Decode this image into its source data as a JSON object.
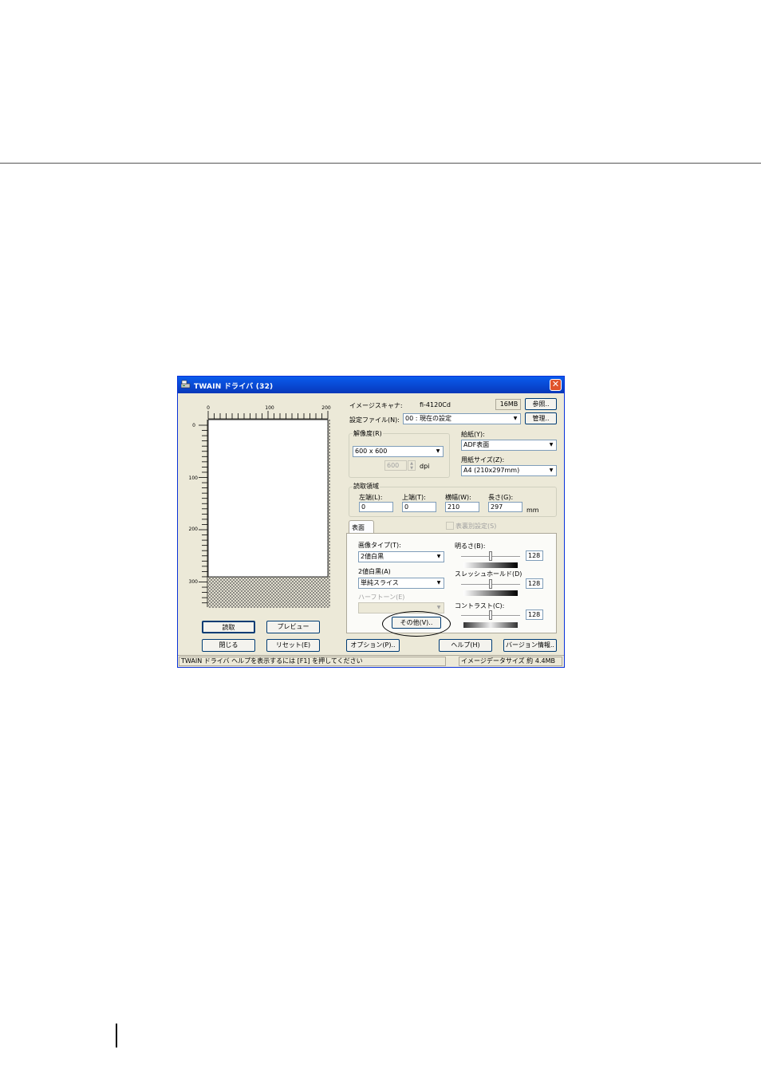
{
  "window": {
    "title": "TWAIN ドライバ (32)",
    "close_glyph": "✕"
  },
  "preview": {
    "top_ruler_ticks": [
      "0",
      "100",
      "200"
    ],
    "left_ruler_ticks": [
      "0",
      "100",
      "200",
      "300"
    ]
  },
  "scanner": {
    "label": "イメージスキャナ:",
    "model": "fi-4120Cd",
    "memory": "16MB",
    "browse_button": "参照.."
  },
  "settings_file": {
    "label": "設定ファイル(N):",
    "value": "00 : 現在の設定",
    "manage_button": "管理.."
  },
  "resolution": {
    "group_label": "解像度(R)",
    "value": "600 x 600",
    "custom_value": "600",
    "unit": "dpi"
  },
  "paper": {
    "feed_label": "給紙(Y):",
    "feed_value": "ADF表面",
    "size_label": "用紙サイズ(Z):",
    "size_value": "A4 (210x297mm)"
  },
  "scan_area": {
    "group_label": "読取領域",
    "left_label": "左端(L):",
    "left_value": "0",
    "top_label": "上端(T):",
    "top_value": "0",
    "width_label": "横幅(W):",
    "width_value": "210",
    "length_label": "長さ(G):",
    "length_value": "297",
    "unit": "mm"
  },
  "side": {
    "tab_label": "表面",
    "separate_checkbox": "表裏別設定(S)"
  },
  "image": {
    "type_label": "画像タイプ(T):",
    "type_value": "2値白黒",
    "mode_label": "2値白黒(A)",
    "mode_value": "単純スライス",
    "halftone_label": "ハーフトーン(E)",
    "other_button": "その他(V).."
  },
  "adjust": {
    "brightness_label": "明るさ(B):",
    "brightness_value": "128",
    "brightness_level": 0.5,
    "threshold_label": "スレッシュホールド(D)",
    "threshold_value": "128",
    "threshold_level": 0.5,
    "contrast_label": "コントラスト(C):",
    "contrast_value": "128",
    "contrast_level": 0.5
  },
  "buttons": {
    "scan": "読取",
    "preview": "プレビュー",
    "close": "閉じる",
    "reset": "リセット(E)",
    "options": "オプション(P)..",
    "help": "ヘルプ(H)",
    "version": "バージョン情報.."
  },
  "status": {
    "help_text": "TWAIN ドライバ ヘルプを表示するには [F1] を押してください",
    "size_label": "イメージデータサイズ 約",
    "size_value": "4.4MB"
  }
}
